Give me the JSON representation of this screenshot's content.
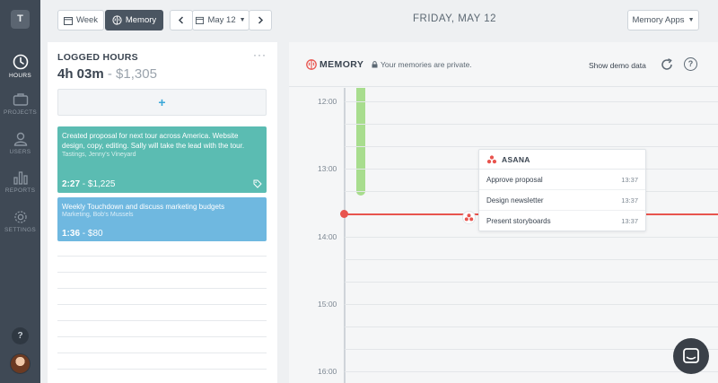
{
  "sidebar": {
    "workspace_initial": "T",
    "items": [
      {
        "label": "HOURS",
        "icon": "clock-icon",
        "active": true
      },
      {
        "label": "PROJECTS",
        "icon": "briefcase-icon",
        "active": false
      },
      {
        "label": "USERS",
        "icon": "user-icon",
        "active": false
      },
      {
        "label": "REPORTS",
        "icon": "bar-chart-icon",
        "active": false
      },
      {
        "label": "SETTINGS",
        "icon": "gear-icon",
        "active": false
      }
    ],
    "help_label": "?"
  },
  "toolbar": {
    "week_label": "Week",
    "memory_label": "Memory",
    "date_picker_label": "May 12",
    "title": "FRIDAY, MAY 12",
    "memory_apps_label": "Memory Apps"
  },
  "logged": {
    "title": "LOGGED HOURS",
    "menu": "···",
    "total_hours": "4h 03m",
    "total_money": " - $1,305",
    "add_label": "+",
    "entries": [
      {
        "description": "Created proposal for next tour across America. Website design, copy, editing. Sally will take the lead with the tour.",
        "subtitle": "Tastings, Jenny's Vineyard",
        "duration": "2:27",
        "amount": " - $1,225",
        "color": "#5bbcb2"
      },
      {
        "description": "Weekly Touchdown and discuss marketing budgets",
        "subtitle": "Marketing, Bob's Mussels",
        "duration": "1:36",
        "amount": " - $80",
        "color": "#6fb8e0"
      }
    ]
  },
  "memory": {
    "title": "MEMORY",
    "private_note": "Your memories are private.",
    "demo_label": "Show demo data",
    "help_label": "?",
    "hours": [
      "12:00",
      "13:00",
      "14:00",
      "15:00",
      "16:00"
    ],
    "asana": {
      "name": "ASANA",
      "tasks": [
        {
          "title": "Approve proposal",
          "time": "13:37"
        },
        {
          "title": "Design newsletter",
          "time": "13:37"
        },
        {
          "title": "Present storyboards",
          "time": "13:37"
        }
      ]
    },
    "accent_color": "#e8544e"
  }
}
